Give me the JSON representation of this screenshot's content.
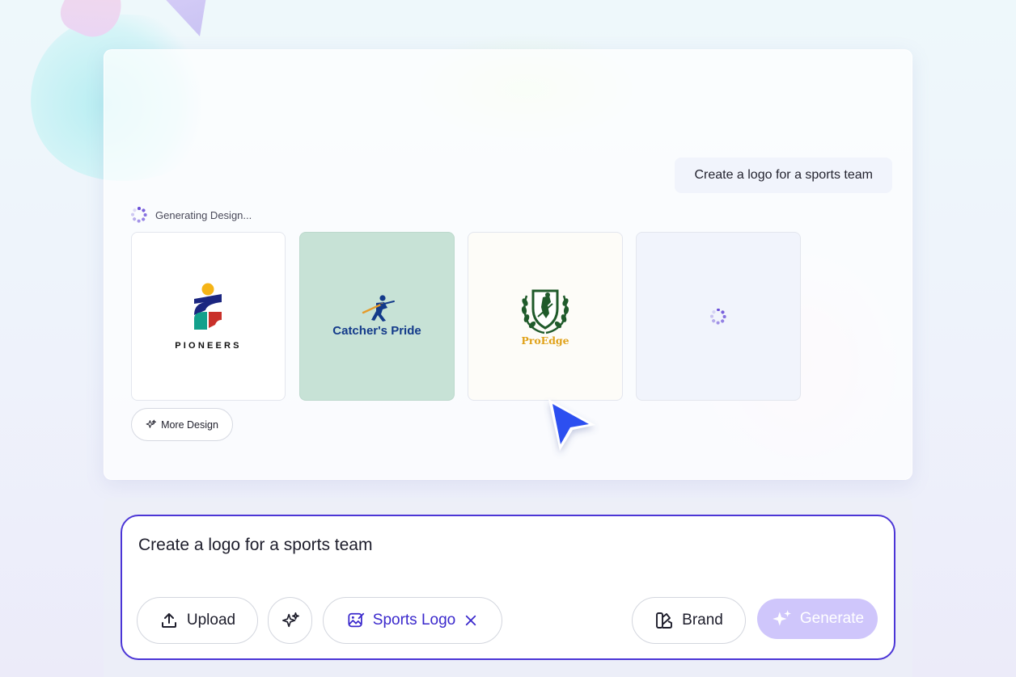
{
  "chat": {
    "user_message": "Create a logo for a sports team",
    "status_text": "Generating Design...",
    "designs": [
      {
        "brand": "PIONEERS"
      },
      {
        "brand": "Catcher's Pride"
      },
      {
        "brand": "ProEdge"
      },
      {
        "brand": ""
      }
    ],
    "more_button_label": "More Design"
  },
  "composer": {
    "prompt_text": "Create a logo for a sports team",
    "upload_label": "Upload",
    "tag_label": "Sports Logo",
    "brand_label": "Brand",
    "generate_label": "Generate"
  },
  "colors": {
    "accent": "#4b35d6",
    "generate_disabled": "#cfc6fb",
    "card_green": "#c7e2d6"
  },
  "icons": {
    "status": "spinner-icon",
    "more": "sparkle-icon",
    "upload": "upload-icon",
    "magic": "sparkle-icon",
    "tag": "image-edit-icon",
    "remove": "close-icon",
    "brand": "palette-icon",
    "generate": "sparkle-icon"
  }
}
